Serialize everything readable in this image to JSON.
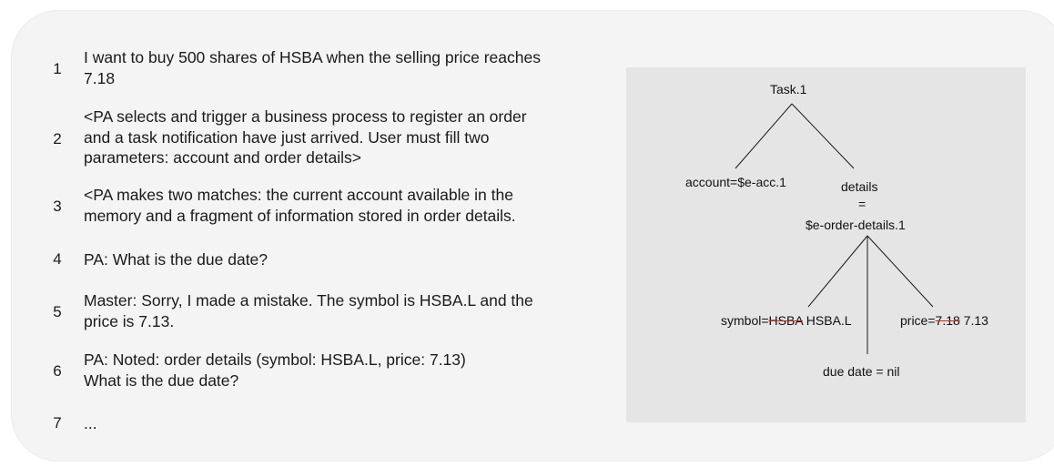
{
  "dialogue": [
    {
      "num": "1",
      "lines": [
        "I want to buy 500 shares of HSBA when the selling price reaches",
        "7.18"
      ]
    },
    {
      "num": "2",
      "lines": [
        "<PA selects and trigger a business process to register an order",
        "and a task notification have just arrived. User must fill two",
        "parameters: account and order details>"
      ]
    },
    {
      "num": "3",
      "lines": [
        "<PA makes two matches: the current account available in the",
        "memory and a fragment of information stored in order details."
      ]
    },
    {
      "num": "4",
      "lines": [
        "PA: What is the due date?"
      ]
    },
    {
      "num": "5",
      "lines": [
        "Master: Sorry, I made a mistake. The symbol is HSBA.L and the",
        "price is 7.13."
      ]
    },
    {
      "num": "6",
      "lines": [
        "PA: Noted: order details (symbol: HSBA.L, price: 7.13)",
        "What is the due date?"
      ]
    },
    {
      "num": "7",
      "lines": [
        "..."
      ]
    }
  ],
  "tree": {
    "root": "Task.1",
    "account": "account=$e-acc.1",
    "details_top": "details",
    "details_eq": "=",
    "details_bottom": "$e-order-details.1",
    "symbol_prefix": "symbol=",
    "symbol_old": "HSBA",
    "symbol_new": " HSBA.L",
    "price_prefix": "price=",
    "price_old": "7.18",
    "price_new": " 7.13",
    "due_date": "due date = nil"
  },
  "colors": {
    "strike": "#cc2222",
    "panel": "#e5e5e5",
    "card": "#f4f4f4"
  }
}
